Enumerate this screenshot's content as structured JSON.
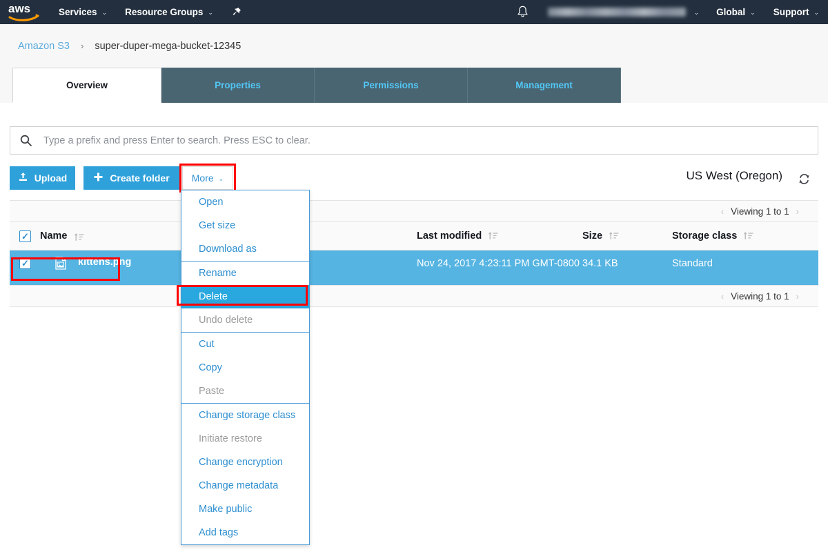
{
  "topnav": {
    "logo_alt": "aws",
    "services_label": "Services",
    "resource_groups_label": "Resource Groups",
    "pin_icon": "pin-icon",
    "bell_icon": "bell-icon",
    "account_label": "",
    "global_label": "Global",
    "support_label": "Support",
    "caret": "⌄"
  },
  "breadcrumb": {
    "root_label": "Amazon S3",
    "separator": "›",
    "current_label": "super-duper-mega-bucket-12345"
  },
  "tabs": [
    {
      "label": "Overview",
      "active": true
    },
    {
      "label": "Properties",
      "active": false
    },
    {
      "label": "Permissions",
      "active": false
    },
    {
      "label": "Management",
      "active": false
    }
  ],
  "search": {
    "icon": "search-icon",
    "placeholder": "Type a prefix and press Enter to search. Press ESC to clear.",
    "value": ""
  },
  "toolbar": {
    "upload_label": "Upload",
    "upload_icon": "upload-icon",
    "create_folder_label": "Create folder",
    "create_folder_icon": "plus-icon",
    "more_label": "More",
    "more_caret": "⌄",
    "region_label": "US West (Oregon)",
    "refresh_icon": "refresh-icon"
  },
  "more_menu": {
    "items": [
      {
        "label": "Open",
        "state": "enabled"
      },
      {
        "label": "Get size",
        "state": "enabled"
      },
      {
        "label": "Download as",
        "state": "enabled"
      },
      {
        "label": "Rename",
        "state": "enabled"
      },
      {
        "label": "Delete",
        "state": "selected"
      },
      {
        "label": "Undo delete",
        "state": "disabled"
      },
      {
        "label": "Cut",
        "state": "enabled"
      },
      {
        "label": "Copy",
        "state": "enabled"
      },
      {
        "label": "Paste",
        "state": "disabled"
      },
      {
        "label": "Change storage class",
        "state": "enabled"
      },
      {
        "label": "Initiate restore",
        "state": "disabled"
      },
      {
        "label": "Change encryption",
        "state": "enabled"
      },
      {
        "label": "Change metadata",
        "state": "enabled"
      },
      {
        "label": "Make public",
        "state": "enabled"
      },
      {
        "label": "Add tags",
        "state": "enabled"
      }
    ]
  },
  "table": {
    "pager_top_label": "Viewing 1 to 1",
    "pager_bottom_label": "Viewing 1 to 1",
    "pager_prev": "‹",
    "pager_next": "›",
    "columns": {
      "name": "Name",
      "last_modified": "Last modified",
      "size": "Size",
      "storage_class": "Storage class"
    },
    "header_checkbox_checked": true,
    "rows": [
      {
        "checked": true,
        "file_icon": "image-file-icon",
        "name": "kittens.png",
        "last_modified": "Nov 24, 2017 4:23:11 PM GMT-0800",
        "size": "34.1 KB",
        "storage_class": "Standard",
        "selected": true
      }
    ]
  },
  "annotations": {
    "more_button_box": "red-highlight-box",
    "delete_item_box": "red-highlight-box",
    "file_row_box": "red-highlight-box",
    "color": "#ff0000"
  },
  "colors": {
    "nav_bg": "#232f3e",
    "accent_blue": "#2ea1db",
    "tab_inactive_bg": "#4a6572",
    "tab_link": "#52c7f5",
    "row_selected": "#55b4e2",
    "menu_selected": "#29a8e0",
    "link": "#2e8fd0",
    "highlight_red": "#ff0000"
  }
}
